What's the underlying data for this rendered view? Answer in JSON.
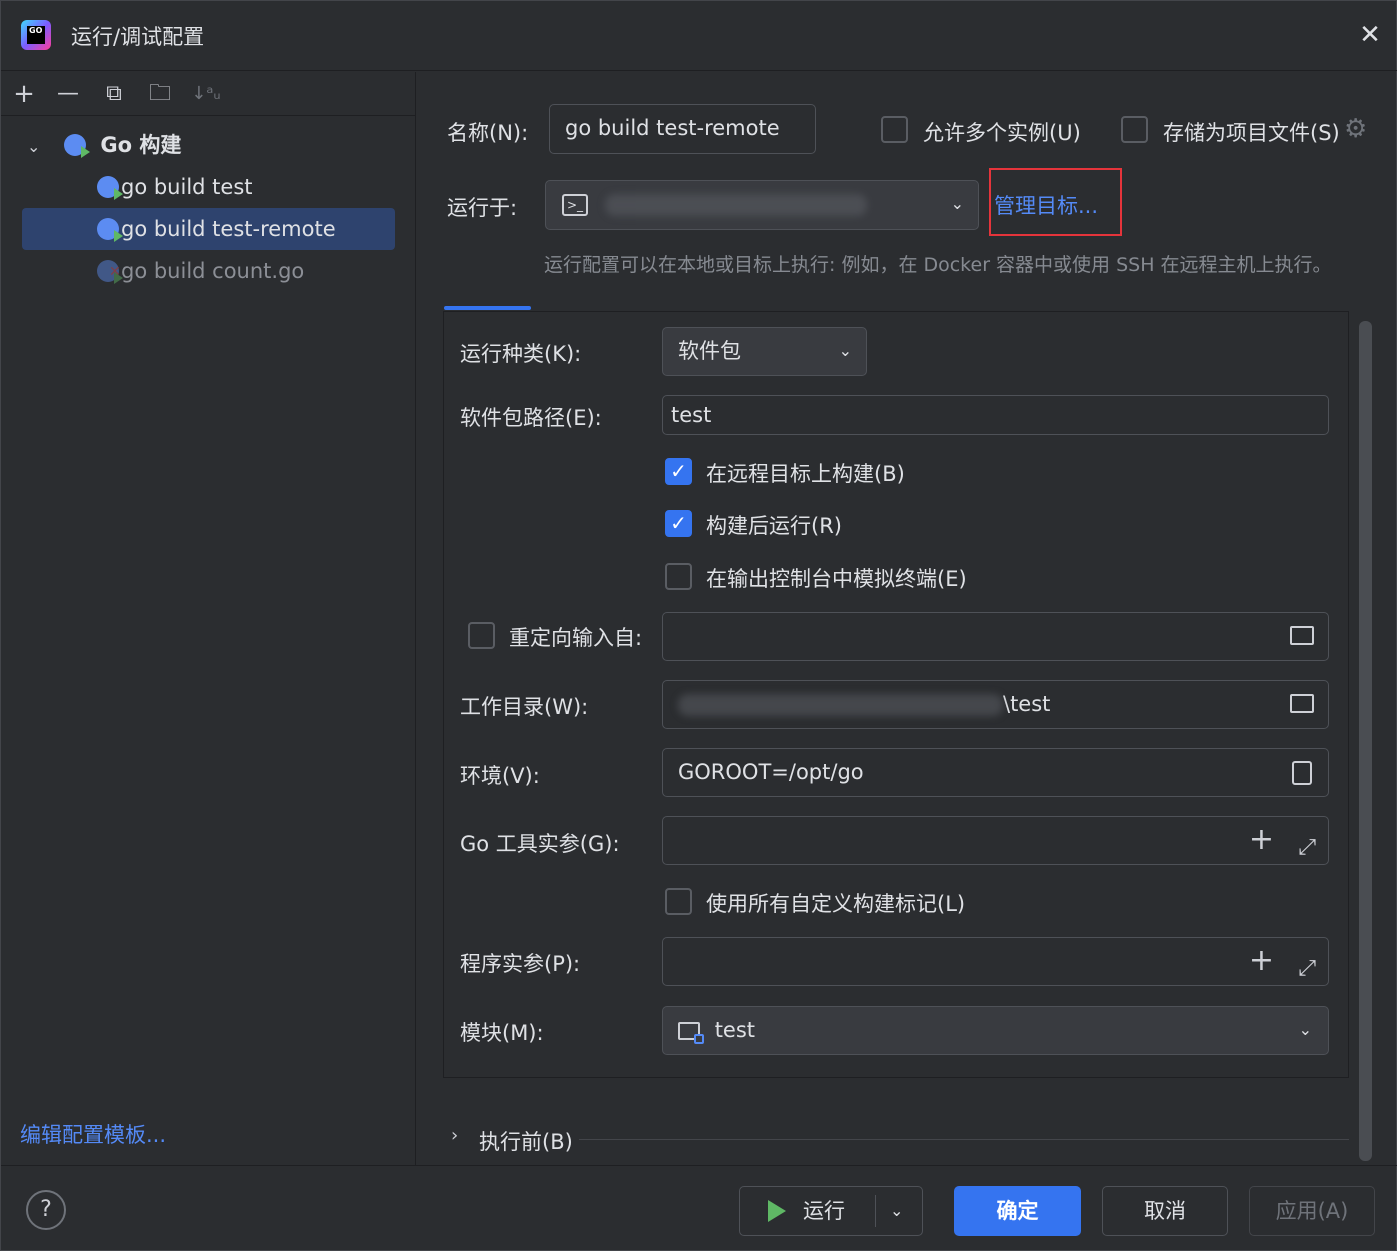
{
  "window": {
    "title": "运行/调试配置",
    "close": "✕",
    "logo_text": "GO"
  },
  "toolbar": {
    "add": "+",
    "remove": "—",
    "copy": "⧉",
    "folder": "🗀",
    "sort": "↓ᵃᵤ"
  },
  "tree": {
    "group_label": "Go 构建",
    "items": [
      {
        "label": "go build test"
      },
      {
        "label": "go build test-remote"
      },
      {
        "label": "go build count.go"
      }
    ],
    "edit_templates": "编辑配置模板..."
  },
  "form": {
    "name_label": "名称(N):",
    "name_value": "go build test-remote",
    "allow_multiple": "允许多个实例(U)",
    "store_as_file": "存储为项目文件(S)",
    "run_on_label": "运行于:",
    "manage_targets": "管理目标...",
    "run_on_hint": "运行配置可以在本地或目标上执行: 例如，在 Docker 容器中或使用 SSH 在远程主机上执行。",
    "run_kind_label": "运行种类(K):",
    "run_kind_value": "软件包",
    "package_path_label": "软件包路径(E):",
    "package_path_value": "test",
    "build_on_remote": "在远程目标上构建(B)",
    "run_after_build": "构建后运行(R)",
    "emulate_terminal": "在输出控制台中模拟终端(E)",
    "redirect_input": "重定向输入自:",
    "working_dir_label": "工作目录(W):",
    "working_dir_suffix": "\\test",
    "env_label": "环境(V):",
    "env_value": "GOROOT=/opt/go",
    "go_tool_args_label": "Go 工具实参(G):",
    "use_all_tags": "使用所有自定义构建标记(L)",
    "program_args_label": "程序实参(P):",
    "module_label": "模块(M):",
    "module_value": "test",
    "before_launch": "执行前(B)"
  },
  "buttons": {
    "help": "?",
    "run": "运行",
    "ok": "确定",
    "cancel": "取消",
    "apply": "应用(A)"
  },
  "colors": {
    "accent": "#3574f0",
    "link": "#548af7",
    "highlight_box": "#e5343b",
    "selection": "#2e436e"
  }
}
